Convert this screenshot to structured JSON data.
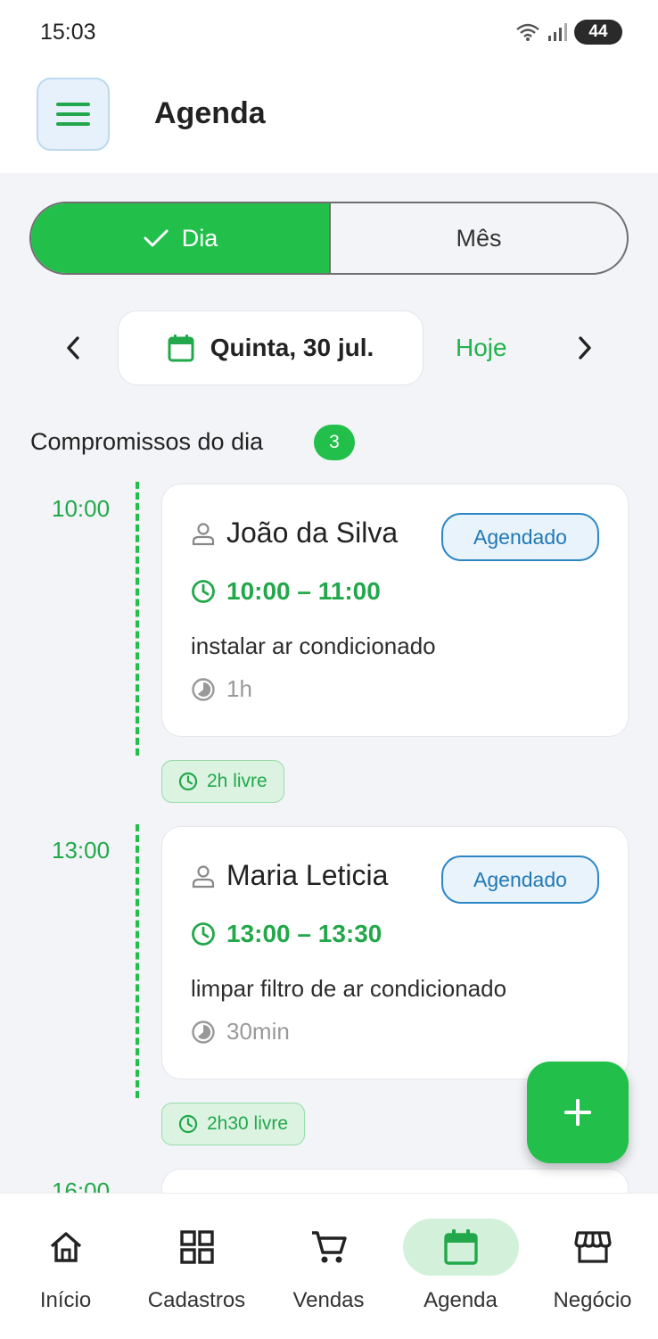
{
  "status_bar": {
    "time": "15:03",
    "battery": "44"
  },
  "app_bar": {
    "title": "Agenda",
    "menu_icon": "hamburger-icon"
  },
  "view_toggle": {
    "day_label": "Dia",
    "month_label": "Mês",
    "selected": "Dia"
  },
  "date_nav": {
    "date": "Quinta, 30 jul.",
    "today_label": "Hoje"
  },
  "appointments_section": {
    "title": "Compromissos do dia",
    "count": "3"
  },
  "appointments": [
    {
      "slot_time": "10:00",
      "client": "João da Silva",
      "status": "Agendado",
      "time_range": "10:00 – 11:00",
      "description": "instalar ar condicionado",
      "duration": "1h"
    },
    {
      "slot_time": "13:00",
      "client": "Maria Leticia",
      "status": "Agendado",
      "time_range": "13:00 – 13:30",
      "description": "limpar filtro de ar condicionado",
      "duration": "30min"
    },
    {
      "slot_time": "16:00"
    }
  ],
  "free_slots": [
    {
      "label": "2h livre"
    },
    {
      "label": "2h30 livre"
    }
  ],
  "bottom_nav": [
    {
      "label": "Início",
      "icon": "home-icon"
    },
    {
      "label": "Cadastros",
      "icon": "grid-icon"
    },
    {
      "label": "Vendas",
      "icon": "cart-icon"
    },
    {
      "label": "Agenda",
      "icon": "calendar-icon",
      "active": true
    },
    {
      "label": "Negócio",
      "icon": "store-icon"
    }
  ],
  "colors": {
    "accent": "#22c04b",
    "status_blue": "#2278b5",
    "background": "#f2f4f7"
  }
}
